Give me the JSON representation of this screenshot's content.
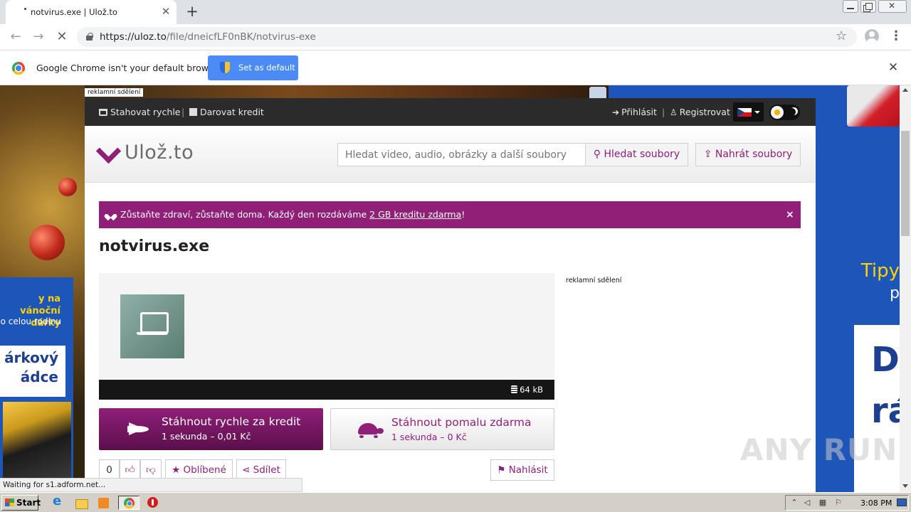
{
  "browser": {
    "tab_title": "notvirus.exe | Ulož.to",
    "url_host": "https://uloz.to",
    "url_path": "/file/dneicfLF0nBK/notvirus-exe",
    "infobar_text": "Google Chrome isn't your default browser",
    "infobar_button": "Set as default",
    "status_text": "Waiting for s1.adform.net..."
  },
  "ads": {
    "label": "reklamní sdělení",
    "left_line1": "y na vánoční dárky",
    "left_line2": "o celou rodinu",
    "left_line3": "árkový ádce",
    "right_line1": "Tipy",
    "right_line2": "p",
    "right_line3": "D rá"
  },
  "site": {
    "topbar": {
      "fast_download": "Stahovat rychle",
      "donate": "Darovat kredit",
      "login": "Přihlásit",
      "register": "Registrovat",
      "separator": "|"
    },
    "logo": "Ulož.to",
    "search": {
      "placeholder": "Hledat video, audio, obrázky a další soubory",
      "button": "Hledat soubory"
    },
    "upload_button": "Nahrát soubory",
    "banner": {
      "text_before": "Zůstaňte zdraví, zůstaňte doma. Každý den rozdáváme ",
      "link": "2 GB kreditu zdarma",
      "text_after": "!",
      "close": "×"
    },
    "file": {
      "title": "notvirus.exe",
      "size": "64 kB"
    },
    "download_fast": {
      "title": "Stáhnout rychle za kredit",
      "subtitle": "1 sekunda – 0,01 Kč"
    },
    "download_slow": {
      "title": "Stáhnout pomalu zdarma",
      "subtitle": "1 sekunda – 0 Kč"
    },
    "actions": {
      "like_count": "0",
      "favorite": "Oblíbené",
      "share": "Sdílet",
      "report": "Nahlásit"
    }
  },
  "watermark": "ANY RUN",
  "taskbar": {
    "start": "Start",
    "clock": "3:08 PM"
  },
  "colors": {
    "brand": "#8f1f77",
    "chrome_button": "#4b8bf5",
    "ad_blue": "#1d56b8"
  }
}
